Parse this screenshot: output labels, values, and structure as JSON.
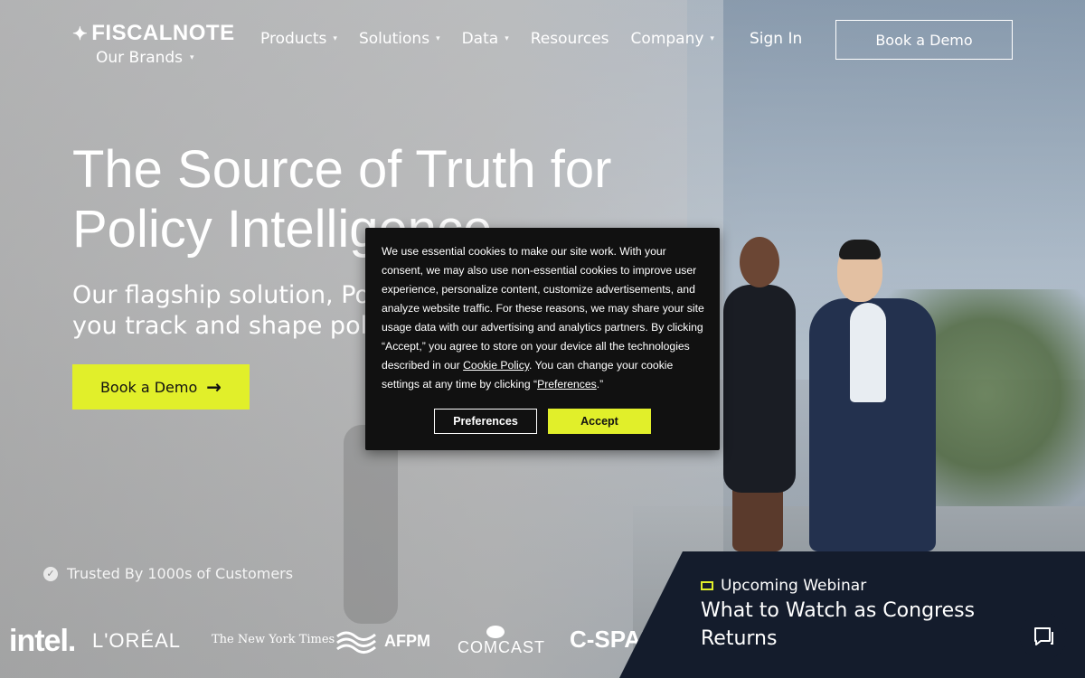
{
  "nav": {
    "logo": "FISCALNOTE",
    "brands_label": "Our Brands",
    "menu": [
      {
        "label": "Products"
      },
      {
        "label": "Solutions"
      },
      {
        "label": "Data"
      },
      {
        "label": "Resources"
      },
      {
        "label": "Company"
      }
    ],
    "sign_in": "Sign In",
    "book_demo": "Book a Demo"
  },
  "hero": {
    "headline": "The Source of Truth for Policy Intelligence",
    "subhead": "Our flagship solution, Policy... you track and shape policy",
    "subhead_line1": "Our flagship solution, Polic",
    "subhead_line2": "you track and shape policy",
    "cta": "Book a Demo"
  },
  "trusted": {
    "label": "Trusted By 1000s of Customers",
    "logos": [
      "intel.",
      "L'ORÉAL",
      "The New York Times",
      "AFPM",
      "COMCAST",
      "C-SPAN"
    ]
  },
  "webinar": {
    "tag": "Upcoming Webinar",
    "title": "What to Watch as Congress Returns"
  },
  "cookie": {
    "text_before_link": "We use essential cookies to make our site work. With your consent, we may also use non-essential cookies to improve user experience, personalize content, customize advertisements, and analyze website traffic. For these reasons, we may share your site usage data with our advertising and analytics partners. By clicking “Accept,” you agree to store on your device all the technologies described in our ",
    "link": "Cookie Policy",
    "text_after_link": ". You can change your cookie settings at any time by clicking “",
    "pref_link": "Preferences",
    "text_end": ".”",
    "preferences_button": "Preferences",
    "accept_button": "Accept"
  },
  "colors": {
    "accent": "#e1ef2a",
    "navy": "#141c2c",
    "dialog": "#111111"
  }
}
